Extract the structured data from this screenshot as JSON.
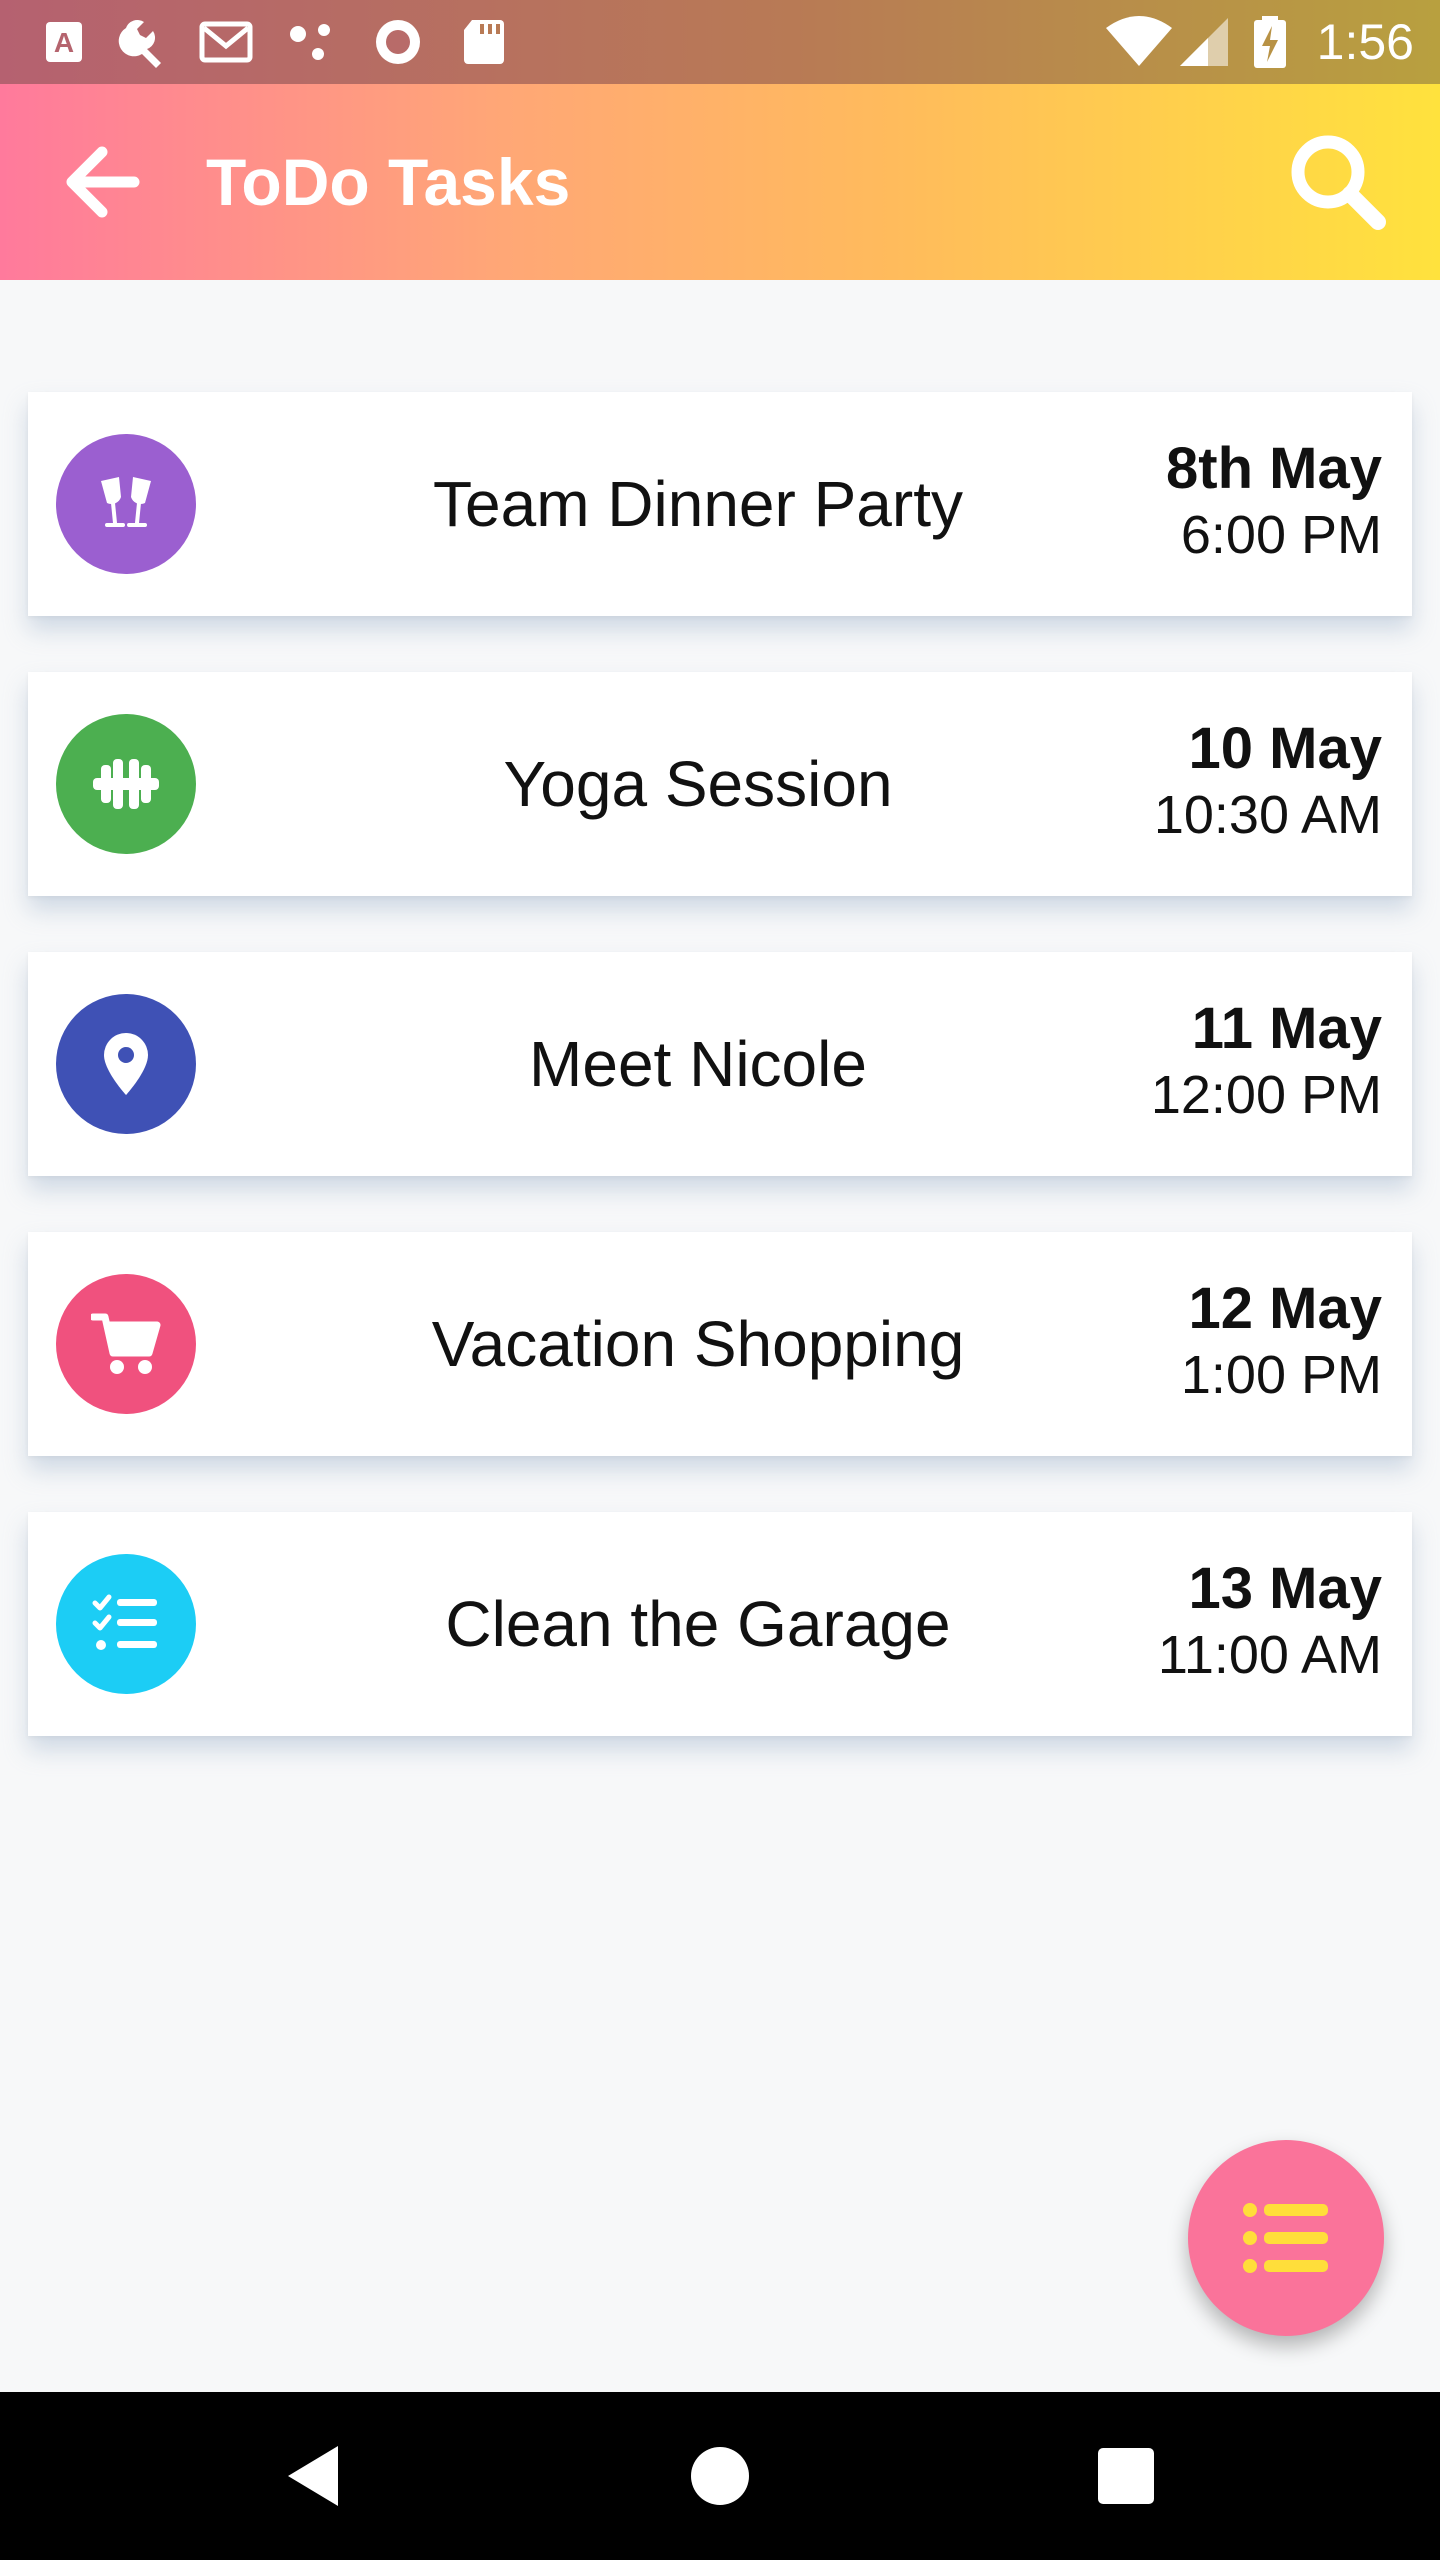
{
  "status_bar": {
    "time": "1:56",
    "left_icons": [
      "text-a-icon",
      "wrench-icon",
      "gmail-icon",
      "dots-icon",
      "record-icon",
      "sd-card-icon"
    ],
    "right_icons": [
      "wifi-icon",
      "signal-icon",
      "battery-charging-icon"
    ]
  },
  "app_bar": {
    "title": "ToDo Tasks",
    "back_icon": "arrow-left-icon",
    "search_icon": "search-icon",
    "gradient": [
      "#ff7a9c",
      "#ffbb5c",
      "#ffe23d"
    ]
  },
  "tasks": [
    {
      "title": "Team Dinner Party",
      "date": "8th May",
      "time": "6:00 PM",
      "icon": "glasses-cheers-icon",
      "color": "#9b5fd0"
    },
    {
      "title": "Yoga Session",
      "date": "10 May",
      "time": "10:30 AM",
      "icon": "dumbbell-icon",
      "color": "#4caf50"
    },
    {
      "title": "Meet Nicole",
      "date": "11 May",
      "time": "12:00 PM",
      "icon": "map-pin-icon",
      "color": "#3f51b5"
    },
    {
      "title": "Vacation Shopping",
      "date": "12 May",
      "time": "1:00 PM",
      "icon": "shopping-cart-icon",
      "color": "#f0517e"
    },
    {
      "title": "Clean the Garage",
      "date": "13 May",
      "time": "11:00 AM",
      "icon": "checklist-icon",
      "color": "#1ccdf5"
    }
  ],
  "fab": {
    "icon": "list-icon",
    "background": "#fa739a",
    "icon_color": "#ffde3a"
  },
  "nav_bar": {
    "back": "nav-back-icon",
    "home": "nav-home-icon",
    "recents": "nav-recents-icon"
  }
}
